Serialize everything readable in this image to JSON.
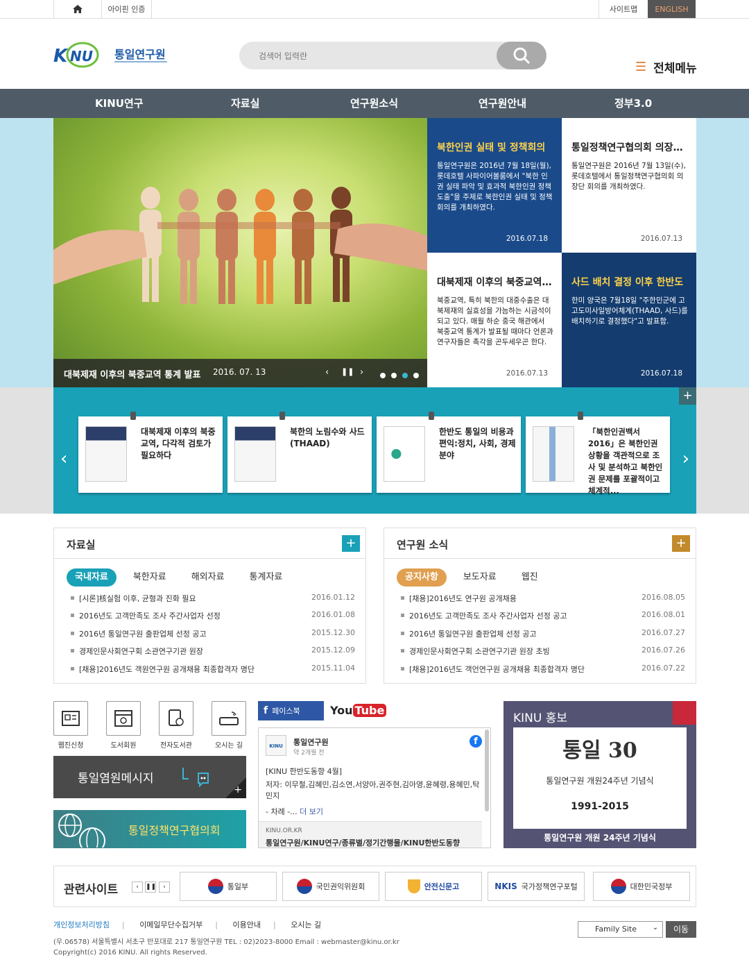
{
  "util": {
    "ipin": "아이핀 인증",
    "sitemap": "사이트맵",
    "english": "ENGLISH"
  },
  "logo": {
    "text": "통일연구원"
  },
  "search": {
    "placeholder": "검색어 입력란"
  },
  "all_menu": "전체메뉴",
  "gnb": [
    "KINU연구",
    "자료실",
    "연구원소식",
    "연구원안내",
    "정부3.0"
  ],
  "visual": {
    "caption": "대북제재 이후의 북중교역 통계 발표",
    "date": "2016. 07. 13",
    "active_dot": 3
  },
  "news": [
    {
      "title": "북한인권 실태 및 정책회의",
      "body": "통일연구원은 2016년 7월 18일(월), 롯데호텔 사파이어볼룸에서 \"북한 인권 실태 파악 및 효과적 북한인권 정책 도출\"을 주제로 북한인권 실태 및 정책회의를 개최하였다.",
      "date": "2016.07.18"
    },
    {
      "title": "통일정책연구협의회 의장단 회의",
      "body": "통일연구원은 2016년 7월 13일(수), 롯데호텔에서 통일정책연구협의회 의장단 회의를 개최하였다.",
      "date": "2016.07.13"
    },
    {
      "title": "대북제재 이후의 북중교역 통계",
      "body": "북중교역, 특히 북한의 대중수출은 대북제재의 실효성을 가늠하는 시금석이 되고 있다. 매월 하순 중국 해관에서 북중교역 통계가 발표될 때마다 언론과 연구자들은 촉각을 곤두세우곤 한다.",
      "date": "2016.07.13"
    },
    {
      "title": "사드 배치 결정 이후 한반도",
      "body": "한미 양국은 7월18일 \"주한민군에 고고도미사일방어체계(THAAD, 사드)를 배치하기로 결정했다\"고 발표함.",
      "date": "2016.07.18"
    }
  ],
  "books": [
    {
      "title": "대북제재 이후의 북중교역, 다각적 검토가 필요하다"
    },
    {
      "title": "북한의 노림수와 사드(THAAD)"
    },
    {
      "title": "한반도 통일의 비용과 편익:정치, 사회, 경제 분야"
    },
    {
      "title": "「북한인권백서 2016」은 북한인권 상황을 객관적으로 조사 및 분석하고 북한인권 문제를 포괄적이고 체계적..."
    }
  ],
  "board_left": {
    "title": "자료실",
    "tabs": [
      "국내자료",
      "북한자료",
      "해외자료",
      "통계자료"
    ],
    "items": [
      {
        "text": "[시론]核실험 이후, 균형과 진화 필요",
        "date": "2016.01.12"
      },
      {
        "text": "2016년도 고객만족도 조사 주간사업자 선정",
        "date": "2016.01.08"
      },
      {
        "text": "2016년 통일연구원 출판업체 선정 공고",
        "date": "2015.12.30"
      },
      {
        "text": "경제인문사회연구회 소관연구기관 원장",
        "date": "2015.12.09"
      },
      {
        "text": "[채용]2016년도 객원연구원 공개채용 최종합격자 명단",
        "date": "2015.11.04"
      }
    ]
  },
  "board_right": {
    "title": "연구원 소식",
    "tabs": [
      "공지사항",
      "보도자료",
      "웹진"
    ],
    "items": [
      {
        "text": "[채용]2016년도 연구원 공개채용",
        "date": "2016.08.05"
      },
      {
        "text": "2016년도 고객만족도 조사 주간사업자 선정 공고",
        "date": "2016.08.01"
      },
      {
        "text": "2016년 통일연구원 출판업체 선정 공고",
        "date": "2016.07.27"
      },
      {
        "text": "경제인문사회연구회 소관연구기관 원장 초빙",
        "date": "2016.07.26"
      },
      {
        "text": "[채용]2016년도 객언연구원 공개채용 최종합격자 명단",
        "date": "2016.07.22"
      }
    ]
  },
  "quick": [
    "웹진신청",
    "도서회원",
    "전자도서관",
    "오시는 길"
  ],
  "message": "통일염원메시지",
  "council": "통일정책연구협의회",
  "facebook": {
    "tab": "페이스북",
    "page": "통일연구원",
    "ago": "약 2개월 전",
    "post_title": "[KINU 한반도동향 4월]",
    "post_body": "저자: 이무철,김혜민,김소연,서양아,권주현,김아영,윤혜령,용혜민,탁민지",
    "more_prefix": "- 차례 -...",
    "more": "더 보기",
    "link_domain": "KINU.OR.KR",
    "link_title": "통일연구원/KINU연구/종류별/정기간행물/KINU한반도동향"
  },
  "youtube": "YouTube",
  "promo": {
    "title": "KINU 홍보",
    "headline": "통일 30",
    "sub": "통일연구원 개원24주년 기념식",
    "years": "1991-2015",
    "caption": "통일연구원 개원 24주년 기념식"
  },
  "related": {
    "title": "관련사이트",
    "sites": [
      "통일부",
      "국민권익위원회",
      "안전신문고",
      "국가정책연구포털",
      "대한민국정부"
    ]
  },
  "footer": {
    "links": [
      "개인정보처리방침",
      "이메일무단수집거부",
      "이용안내",
      "오시는 길"
    ],
    "address": "(우.06578) 서울특별시 서초구 반포대로 217 통일연구원   TEL : 02)2023-8000   Email : webmaster@kinu.or.kr",
    "copyright": "Copyright(c) 2016 KINU. All rights Reserved.",
    "family_site": "Family Site",
    "go": "이동"
  },
  "colors": {
    "gnb": "#4f5b66",
    "teal": "#19a1b8",
    "orange": "#e07a2a",
    "gold": "#c28a2c",
    "navy": "#1a4a8a"
  }
}
